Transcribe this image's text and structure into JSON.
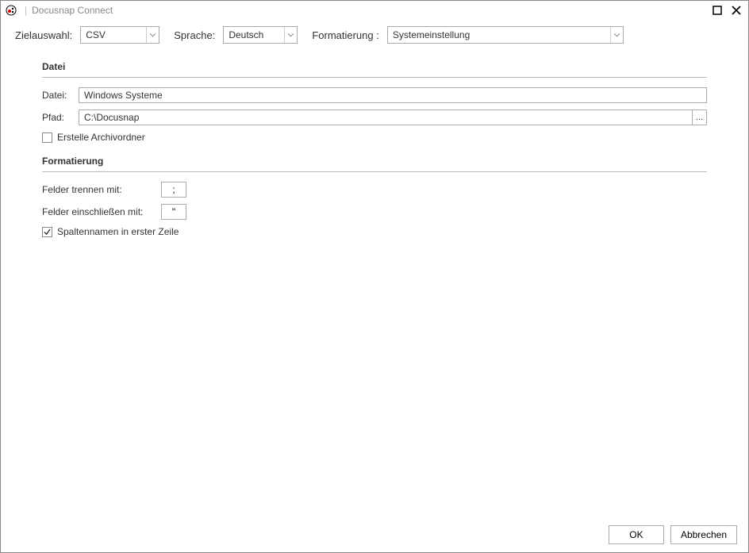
{
  "window": {
    "title": "Docusnap Connect"
  },
  "toprow": {
    "ziel_label": "Zielauswahl:",
    "ziel_value": "CSV",
    "sprache_label": "Sprache:",
    "sprache_value": "Deutsch",
    "format_label": "Formatierung :",
    "format_value": "Systemeinstellung"
  },
  "datei_section": {
    "title": "Datei",
    "datei_label": "Datei:",
    "datei_value": "Windows Systeme",
    "pfad_label": "Pfad:",
    "pfad_value": "C:\\Docusnap",
    "browse_label": "...",
    "archiv_label": "Erstelle Archivordner"
  },
  "format_section": {
    "title": "Formatierung",
    "trennen_label": "Felder trennen mit:",
    "trennen_value": ";",
    "einschl_label": "Felder einschließen mit:",
    "einschl_value": "\"",
    "spalten_label": "Spaltennamen in erster Zeile"
  },
  "footer": {
    "ok": "OK",
    "cancel": "Abbrechen"
  }
}
